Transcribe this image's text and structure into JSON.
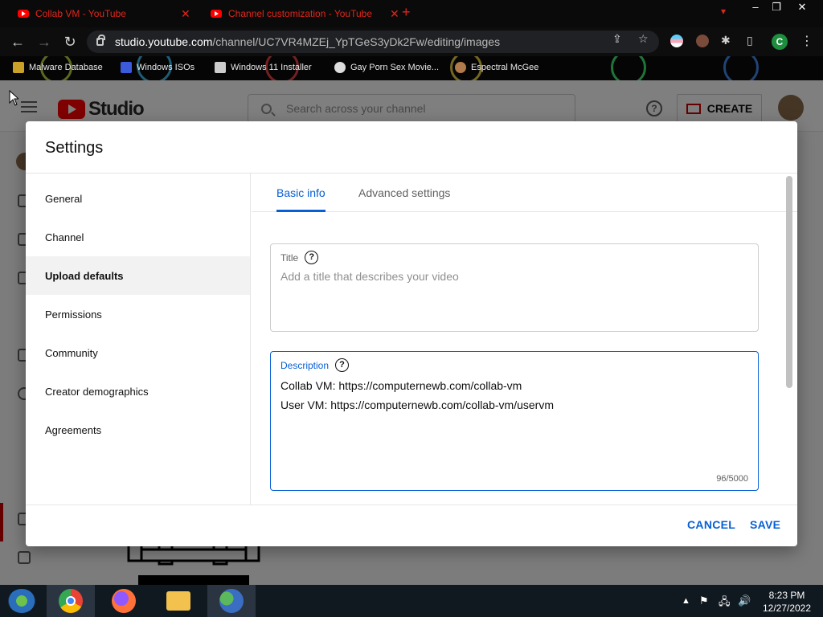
{
  "browser": {
    "tabs": [
      {
        "title": "Collab VM - YouTube"
      },
      {
        "title": "Channel customization - YouTube"
      }
    ],
    "new_tab": "+",
    "window_controls": [
      "–",
      "❐",
      "✕"
    ],
    "url_main": "studio.youtube.com",
    "url_path": "/channel/UC7VR4MZEj_YpTGeS3yDk2Fw/editing/images",
    "profile_initial": "C",
    "bookmarks": [
      {
        "label": "Malware Database",
        "color": "#c9a227"
      },
      {
        "label": "Windows ISOs",
        "color": "#3b5bdb"
      },
      {
        "label": "Windows 11 Installer",
        "color": "#cccccc"
      },
      {
        "label": "Gay Porn Sex Movie...",
        "color": "#dddddd"
      },
      {
        "label": "Espectral McGee",
        "color": "#b07a4a"
      }
    ]
  },
  "studio": {
    "logo_text": "Studio",
    "search_placeholder": "Search across your channel",
    "create_label": "CREATE",
    "help_glyph": "?"
  },
  "dialog": {
    "title": "Settings",
    "nav": [
      {
        "label": "General",
        "active": false
      },
      {
        "label": "Channel",
        "active": false
      },
      {
        "label": "Upload defaults",
        "active": true
      },
      {
        "label": "Permissions",
        "active": false
      },
      {
        "label": "Community",
        "active": false
      },
      {
        "label": "Creator demographics",
        "active": false
      },
      {
        "label": "Agreements",
        "active": false
      }
    ],
    "tabs": {
      "basic": "Basic info",
      "advanced": "Advanced settings"
    },
    "title_field": {
      "label": "Title",
      "placeholder": "Add a title that describes your video"
    },
    "description_field": {
      "label": "Description",
      "lines": [
        "Collab VM: https://computernewb.com/collab-vm",
        "User VM: https://computernewb.com/collab-vm/uservm"
      ],
      "counter": "96/5000"
    },
    "cancel_label": "CANCEL",
    "save_label": "SAVE",
    "help_glyph": "?"
  },
  "taskbar": {
    "time": "8:23 PM",
    "date": "12/27/2022"
  },
  "colors": {
    "accent": "#065fd4",
    "brand": "#ff0000",
    "tab_text": "#e0261b"
  }
}
